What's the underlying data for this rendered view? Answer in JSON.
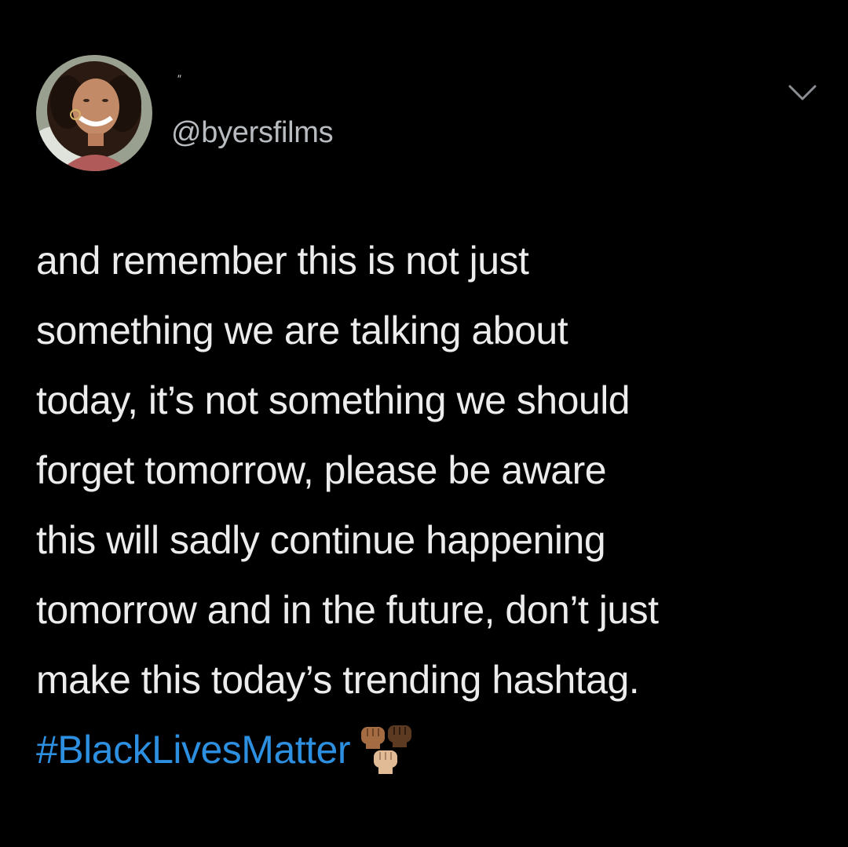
{
  "tweet": {
    "display_name": "″",
    "handle": "@byersfilms",
    "lines": [
      "and remember this is not just",
      "something we are talking about",
      "today, it’s not something we should",
      "forget tomorrow, please be aware",
      "this will sadly continue happening",
      "tomorrow and in the future, don’t just",
      "make this today’s trending hashtag."
    ],
    "hashtag": "#BlackLivesMatter",
    "emoji": "raised-fists-icon"
  },
  "colors": {
    "background": "#000000",
    "text": "#ececec",
    "handle": "#b8bcc0",
    "hashtag": "#2d8fe0",
    "chevron": "#8a8d91"
  }
}
